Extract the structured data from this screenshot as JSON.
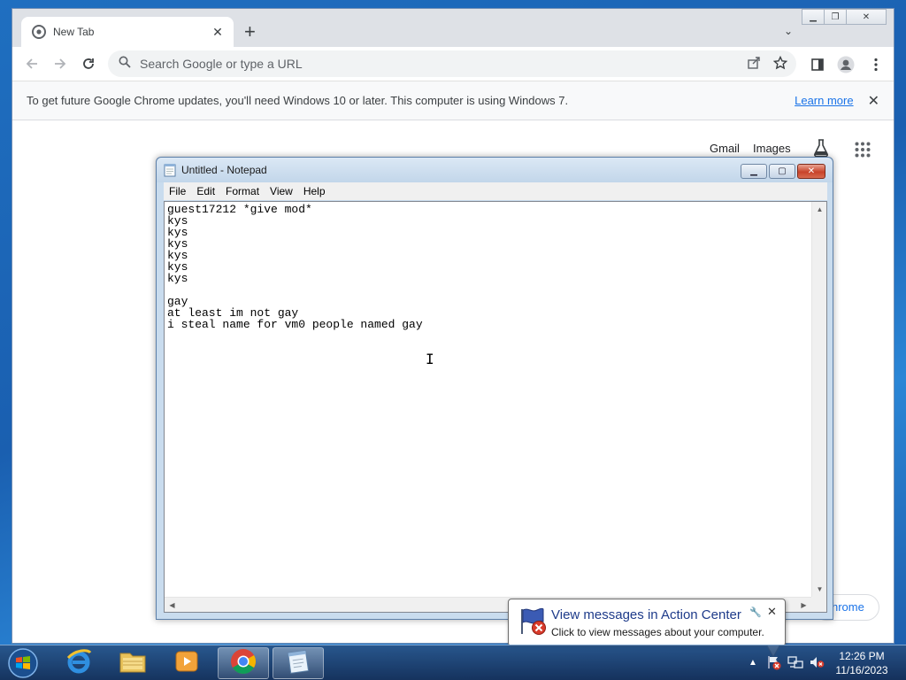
{
  "chrome": {
    "tab": {
      "title": "New Tab"
    },
    "omnibox": {
      "placeholder": "Search Google or type a URL"
    },
    "infobar": {
      "message": "To get future Google Chrome updates, you'll need Windows 10 or later. This computer is using Windows 7.",
      "link": "Learn more"
    },
    "ntp": {
      "links": [
        "Gmail",
        "Images"
      ],
      "customize_label": "hrome"
    }
  },
  "notepad": {
    "title": "Untitled - Notepad",
    "menu": [
      "File",
      "Edit",
      "Format",
      "View",
      "Help"
    ],
    "content": "guest17212 *give mod*\nkys\nkys\nkys\nkys\nkys\nkys\n\ngay\nat least im not gay\ni steal name for vm0 people named gay"
  },
  "balloon": {
    "title": "View messages in Action Center",
    "subtitle": "Click to view messages about your computer."
  },
  "taskbar": {
    "apps": [
      "internet-explorer",
      "windows-explorer",
      "media-player",
      "google-chrome",
      "notepad"
    ],
    "clock": {
      "time": "12:26 PM",
      "date": "11/16/2023"
    }
  },
  "colors": {
    "accent": "#1a73e8",
    "taskbar": "#1e3f6e"
  }
}
